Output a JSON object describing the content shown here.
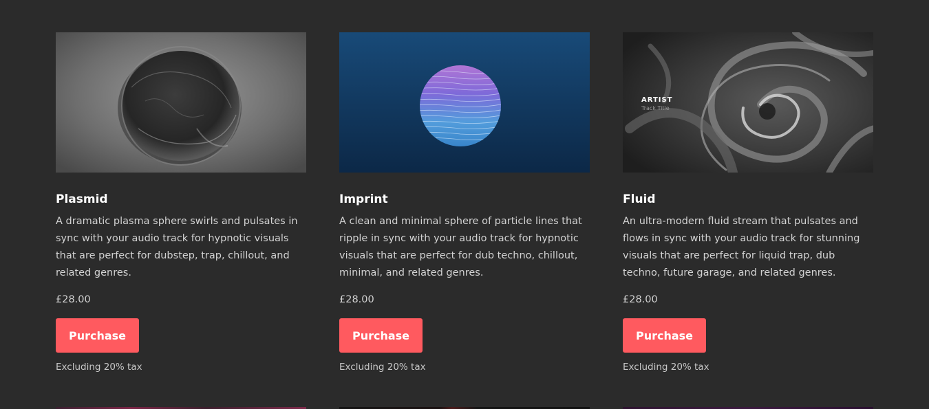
{
  "products": [
    {
      "title": "Plasmid",
      "description": "A dramatic plasma sphere swirls and pulsates in sync with your audio track for hypnotic visuals that are perfect for dubstep, trap, chillout, and related genres.",
      "price": "£28.00",
      "button_label": "Purchase",
      "tax_note": "Excluding 20% tax"
    },
    {
      "title": "Imprint",
      "description": "A clean and minimal sphere of particle lines that ripple in sync with your audio track for hypnotic visuals that are perfect for dub techno, chillout, minimal, and related genres.",
      "price": "£28.00",
      "button_label": "Purchase",
      "tax_note": "Excluding 20% tax"
    },
    {
      "title": "Fluid",
      "description": "An ultra-modern fluid stream that pulsates and flows in sync with your audio track for stunning visuals that are perfect for liquid trap, dub techno, future garage, and related genres.",
      "price": "£28.00",
      "button_label": "Purchase",
      "tax_note": "Excluding 20% tax",
      "thumbnail_artist": "ARTIST",
      "thumbnail_track": "Track Title"
    }
  ],
  "colors": {
    "page_background": "#2b2b2b",
    "button_background": "#ff5a5f",
    "button_text": "#ffffff",
    "title_text": "#ffffff",
    "body_text": "#d2d2d2"
  }
}
